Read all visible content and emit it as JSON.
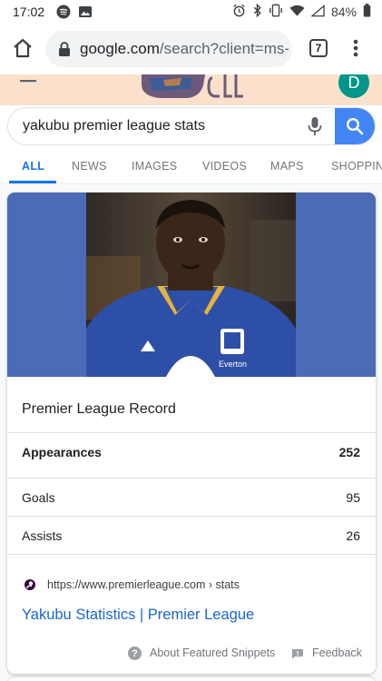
{
  "status_bar": {
    "time": "17:02",
    "battery": "84%",
    "icons_left": [
      "spotify-icon",
      "image-icon"
    ],
    "icons_right": [
      "alarm-icon",
      "bluetooth-icon",
      "vibrate-icon",
      "wifi-icon",
      "signal-icon",
      "battery-icon"
    ]
  },
  "browser": {
    "url_host": "google.com",
    "url_path": "/search?client=ms-",
    "tab_count": "7"
  },
  "header": {
    "avatar_letter": "D"
  },
  "search": {
    "query": "yakubu premier league stats"
  },
  "tabs": [
    {
      "label": "ALL",
      "active": true
    },
    {
      "label": "NEWS",
      "active": false
    },
    {
      "label": "IMAGES",
      "active": false
    },
    {
      "label": "VIDEOS",
      "active": false
    },
    {
      "label": "MAPS",
      "active": false
    },
    {
      "label": "SHOPPING",
      "active": false
    }
  ],
  "card": {
    "title": "Premier League Record",
    "rows": [
      {
        "label": "Appearances",
        "value": "252",
        "bold": true
      },
      {
        "label": "Goals",
        "value": "95",
        "bold": false
      },
      {
        "label": "Assists",
        "value": "26",
        "bold": false
      }
    ],
    "source_url": "https://www.premierleague.com › stats",
    "link_title": "Yakubu Statistics | Premier League",
    "footer": {
      "about_label": "About Featured Snippets",
      "feedback_label": "Feedback"
    },
    "photo_text": {
      "club": "Everton"
    }
  },
  "colors": {
    "accent_blue": "#1a73e8",
    "search_button": "#4285f4",
    "hero_blue": "#4b6bb6",
    "link_blue": "#1967d2",
    "avatar_teal": "#009688"
  }
}
